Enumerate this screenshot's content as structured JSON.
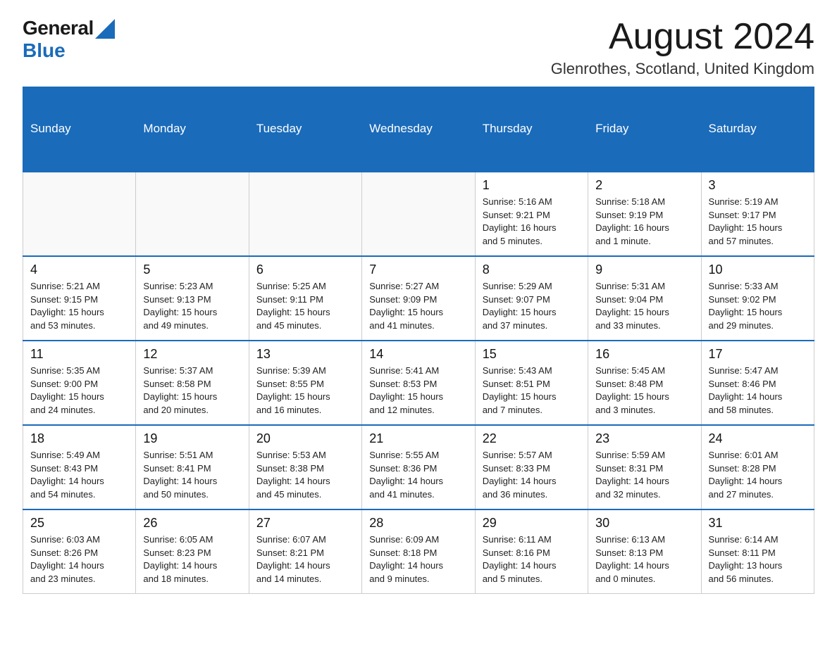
{
  "header": {
    "logo_general": "General",
    "logo_blue": "Blue",
    "month_title": "August 2024",
    "location": "Glenrothes, Scotland, United Kingdom"
  },
  "days_of_week": [
    "Sunday",
    "Monday",
    "Tuesday",
    "Wednesday",
    "Thursday",
    "Friday",
    "Saturday"
  ],
  "weeks": [
    [
      {
        "day": "",
        "info": ""
      },
      {
        "day": "",
        "info": ""
      },
      {
        "day": "",
        "info": ""
      },
      {
        "day": "",
        "info": ""
      },
      {
        "day": "1",
        "info": "Sunrise: 5:16 AM\nSunset: 9:21 PM\nDaylight: 16 hours\nand 5 minutes."
      },
      {
        "day": "2",
        "info": "Sunrise: 5:18 AM\nSunset: 9:19 PM\nDaylight: 16 hours\nand 1 minute."
      },
      {
        "day": "3",
        "info": "Sunrise: 5:19 AM\nSunset: 9:17 PM\nDaylight: 15 hours\nand 57 minutes."
      }
    ],
    [
      {
        "day": "4",
        "info": "Sunrise: 5:21 AM\nSunset: 9:15 PM\nDaylight: 15 hours\nand 53 minutes."
      },
      {
        "day": "5",
        "info": "Sunrise: 5:23 AM\nSunset: 9:13 PM\nDaylight: 15 hours\nand 49 minutes."
      },
      {
        "day": "6",
        "info": "Sunrise: 5:25 AM\nSunset: 9:11 PM\nDaylight: 15 hours\nand 45 minutes."
      },
      {
        "day": "7",
        "info": "Sunrise: 5:27 AM\nSunset: 9:09 PM\nDaylight: 15 hours\nand 41 minutes."
      },
      {
        "day": "8",
        "info": "Sunrise: 5:29 AM\nSunset: 9:07 PM\nDaylight: 15 hours\nand 37 minutes."
      },
      {
        "day": "9",
        "info": "Sunrise: 5:31 AM\nSunset: 9:04 PM\nDaylight: 15 hours\nand 33 minutes."
      },
      {
        "day": "10",
        "info": "Sunrise: 5:33 AM\nSunset: 9:02 PM\nDaylight: 15 hours\nand 29 minutes."
      }
    ],
    [
      {
        "day": "11",
        "info": "Sunrise: 5:35 AM\nSunset: 9:00 PM\nDaylight: 15 hours\nand 24 minutes."
      },
      {
        "day": "12",
        "info": "Sunrise: 5:37 AM\nSunset: 8:58 PM\nDaylight: 15 hours\nand 20 minutes."
      },
      {
        "day": "13",
        "info": "Sunrise: 5:39 AM\nSunset: 8:55 PM\nDaylight: 15 hours\nand 16 minutes."
      },
      {
        "day": "14",
        "info": "Sunrise: 5:41 AM\nSunset: 8:53 PM\nDaylight: 15 hours\nand 12 minutes."
      },
      {
        "day": "15",
        "info": "Sunrise: 5:43 AM\nSunset: 8:51 PM\nDaylight: 15 hours\nand 7 minutes."
      },
      {
        "day": "16",
        "info": "Sunrise: 5:45 AM\nSunset: 8:48 PM\nDaylight: 15 hours\nand 3 minutes."
      },
      {
        "day": "17",
        "info": "Sunrise: 5:47 AM\nSunset: 8:46 PM\nDaylight: 14 hours\nand 58 minutes."
      }
    ],
    [
      {
        "day": "18",
        "info": "Sunrise: 5:49 AM\nSunset: 8:43 PM\nDaylight: 14 hours\nand 54 minutes."
      },
      {
        "day": "19",
        "info": "Sunrise: 5:51 AM\nSunset: 8:41 PM\nDaylight: 14 hours\nand 50 minutes."
      },
      {
        "day": "20",
        "info": "Sunrise: 5:53 AM\nSunset: 8:38 PM\nDaylight: 14 hours\nand 45 minutes."
      },
      {
        "day": "21",
        "info": "Sunrise: 5:55 AM\nSunset: 8:36 PM\nDaylight: 14 hours\nand 41 minutes."
      },
      {
        "day": "22",
        "info": "Sunrise: 5:57 AM\nSunset: 8:33 PM\nDaylight: 14 hours\nand 36 minutes."
      },
      {
        "day": "23",
        "info": "Sunrise: 5:59 AM\nSunset: 8:31 PM\nDaylight: 14 hours\nand 32 minutes."
      },
      {
        "day": "24",
        "info": "Sunrise: 6:01 AM\nSunset: 8:28 PM\nDaylight: 14 hours\nand 27 minutes."
      }
    ],
    [
      {
        "day": "25",
        "info": "Sunrise: 6:03 AM\nSunset: 8:26 PM\nDaylight: 14 hours\nand 23 minutes."
      },
      {
        "day": "26",
        "info": "Sunrise: 6:05 AM\nSunset: 8:23 PM\nDaylight: 14 hours\nand 18 minutes."
      },
      {
        "day": "27",
        "info": "Sunrise: 6:07 AM\nSunset: 8:21 PM\nDaylight: 14 hours\nand 14 minutes."
      },
      {
        "day": "28",
        "info": "Sunrise: 6:09 AM\nSunset: 8:18 PM\nDaylight: 14 hours\nand 9 minutes."
      },
      {
        "day": "29",
        "info": "Sunrise: 6:11 AM\nSunset: 8:16 PM\nDaylight: 14 hours\nand 5 minutes."
      },
      {
        "day": "30",
        "info": "Sunrise: 6:13 AM\nSunset: 8:13 PM\nDaylight: 14 hours\nand 0 minutes."
      },
      {
        "day": "31",
        "info": "Sunrise: 6:14 AM\nSunset: 8:11 PM\nDaylight: 13 hours\nand 56 minutes."
      }
    ]
  ]
}
